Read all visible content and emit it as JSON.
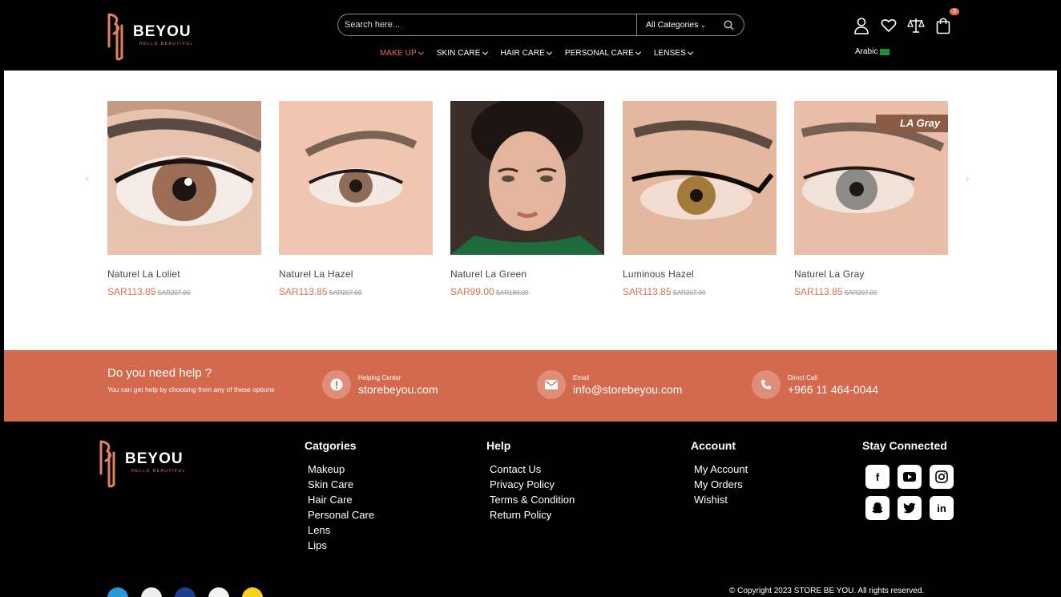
{
  "header": {
    "brand": "BEYOU",
    "tagline": "HELLO BEAUTIFUL",
    "search_placeholder": "Search here...",
    "category_select": "All Categories",
    "nav": [
      {
        "label": "MAKE UP",
        "active": true
      },
      {
        "label": "SKIN CARE",
        "active": false
      },
      {
        "label": "HAIR CARE",
        "active": false
      },
      {
        "label": "PERSONAL CARE",
        "active": false
      },
      {
        "label": "LENSES",
        "active": false
      }
    ],
    "cart_count": "0",
    "language": "Arabic"
  },
  "products": [
    {
      "name": "Naturel La Loliet",
      "price": "SAR113.85",
      "old_price": "SAR207.00"
    },
    {
      "name": "Naturel La Hazel",
      "price": "SAR113.85",
      "old_price": "SAR207.00"
    },
    {
      "name": "Naturel La Green",
      "price": "SAR99.00",
      "old_price": "SAR180.00"
    },
    {
      "name": "Luminous Hazel",
      "price": "SAR113.85",
      "old_price": "SAR207.00"
    },
    {
      "name": "Naturel La Gray",
      "price": "SAR113.85",
      "old_price": "SAR207.00",
      "image_label": "LA Gray"
    }
  ],
  "help": {
    "title": "Do you need help ?",
    "subtitle": "You can get help by choosing from any of these options",
    "items": [
      {
        "label": "Helping Center",
        "value": "storebeyou.com"
      },
      {
        "label": "Email",
        "value": "info@storebeyou.com"
      },
      {
        "label": "Direct Call",
        "value": "+966 11 464-0044"
      }
    ]
  },
  "footer": {
    "categories_title": "Catgories",
    "categories": [
      "Makeup",
      "Skin Care",
      "Hair Care",
      "Personal Care",
      "Lens",
      "Lips"
    ],
    "help_title": "Help",
    "help_links": [
      "Contact Us",
      "Privacy Policy",
      "Terms & Condition",
      "Return Policy"
    ],
    "account_title": "Account",
    "account_links": [
      "My Account",
      "My Orders",
      "Wishist"
    ],
    "social_title": "Stay Connected",
    "social": [
      "facebook-icon",
      "youtube-icon",
      "instagram-icon",
      "snapchat-icon",
      "twitter-icon",
      "linkedin-icon"
    ],
    "copyright": "© Copyright 2023 STORE BE YOU. All rights reserved."
  },
  "colors": {
    "accent": "#e0704e",
    "help_band": "#d46a4d",
    "background": "#000000"
  }
}
